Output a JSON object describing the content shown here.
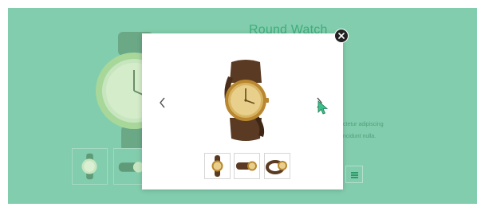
{
  "product": {
    "title": "Round Watch",
    "description_fragments": [
      "ctetur adipiscing",
      "ncidunt nulla."
    ]
  },
  "lightbox": {
    "close_icon": "close-icon",
    "prev_icon": "chevron-left-icon",
    "next_icon": "chevron-right-icon",
    "thumbnail_count": 3
  },
  "colors": {
    "backdrop": "#82cdad",
    "accent": "#2e9a6a",
    "modal": "#ffffff",
    "close_button": "#222222"
  }
}
